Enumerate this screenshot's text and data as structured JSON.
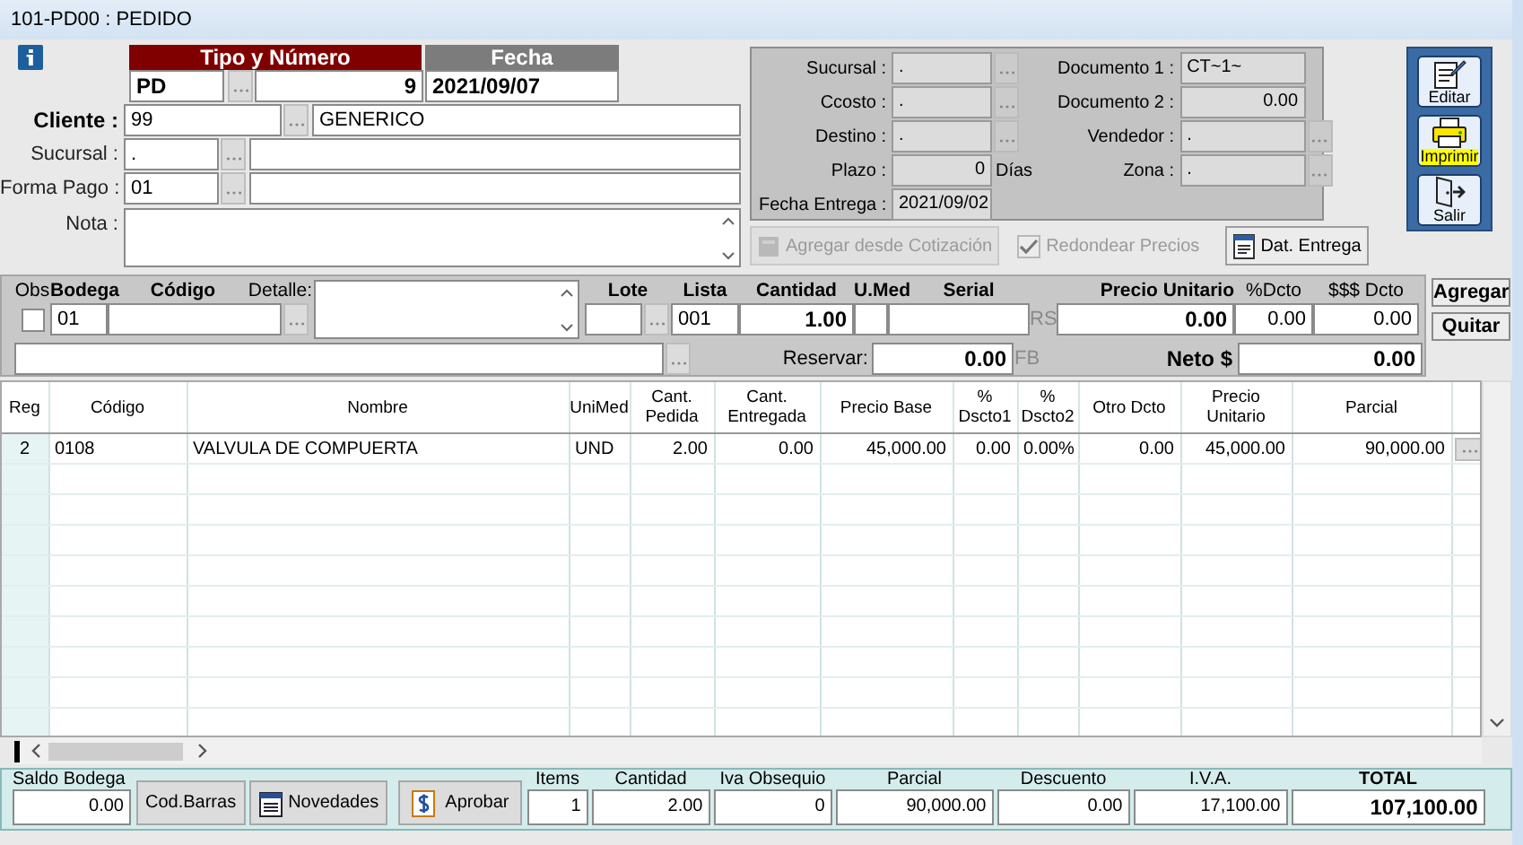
{
  "window": {
    "title": "101-PD00 : PEDIDO"
  },
  "document": {
    "type_header": "Tipo y Número",
    "date_header": "Fecha",
    "type": "PD",
    "number": "9",
    "date": "2021/09/07"
  },
  "client_fields": [
    {
      "label": "Cliente :",
      "code": "99",
      "description": "GENERICO",
      "kind": "primary"
    },
    {
      "label": "Sucursal :",
      "code": ".",
      "kind": "secondary"
    },
    {
      "label": "Forma Pago :",
      "code": "01",
      "kind": "secondary"
    }
  ],
  "note": {
    "label": "Nota :"
  },
  "details_panel": {
    "left": [
      {
        "label": "Sucursal :",
        "value": ".",
        "kind": "text",
        "lookup": true
      },
      {
        "label": "Ccosto :",
        "value": ".",
        "kind": "text",
        "lookup": true
      },
      {
        "label": "Destino :",
        "value": ".",
        "kind": "text",
        "lookup": true
      },
      {
        "label": "Plazo :",
        "value": "0",
        "kind": "number",
        "unit": "Días"
      },
      {
        "label": "Fecha Entrega :",
        "value": "2021/09/02",
        "kind": "text"
      }
    ],
    "right": [
      {
        "label": "Documento 1 :",
        "value": "CT~1~",
        "kind": "text"
      },
      {
        "label": "Documento 2 :",
        "value": "0.00",
        "kind": "number"
      },
      {
        "label": "Vendedor :",
        "value": ".",
        "kind": "text",
        "lookup": true
      },
      {
        "label": "Zona :",
        "value": ".",
        "kind": "text",
        "lookup": true
      }
    ]
  },
  "panel_actions": [
    {
      "kind": "button",
      "label": "Agregar desde Cotización",
      "disabled": true
    },
    {
      "kind": "checkbox",
      "label": "Redondear Precios",
      "checked": true,
      "disabled": true
    },
    {
      "kind": "button",
      "label": "Dat. Entrega",
      "disabled": false
    }
  ],
  "toolbar": [
    {
      "label": "Editar",
      "kind": "edit"
    },
    {
      "label": "Imprimir",
      "kind": "print"
    },
    {
      "label": "Salir",
      "kind": "exit"
    }
  ],
  "line_entry": {
    "obs_label": "Obs",
    "obs_checked": false,
    "bodega_label": "Bodega",
    "bodega": "01",
    "codigo_label": "Código",
    "detalle_label": "Detalle:",
    "lote_label": "Lote",
    "lista_label": "Lista",
    "lista": "001",
    "cantidad_label": "Cantidad",
    "cantidad": "1.00",
    "umed_label": "U.Med",
    "serial_label": "Serial",
    "rs_label": "RS",
    "precio_label": "Precio Unitario",
    "precio": "0.00",
    "dcto_label": "%Dcto",
    "dcto": "0.00",
    "dcto_valor_label": "$$$ Dcto",
    "dcto_valor": "0.00",
    "reservar_label": "Reservar:",
    "reservar": "0.00",
    "fb_label": "FB",
    "neto_label": "Neto $",
    "neto": "0.00"
  },
  "line_buttons": [
    "Agregar",
    "Quitar"
  ],
  "table": {
    "columns": [
      {
        "label": "Reg"
      },
      {
        "label": "Código"
      },
      {
        "label": "Nombre"
      },
      {
        "label": "UniMed"
      },
      {
        "label": "Cant.\nPedida"
      },
      {
        "label": "Cant.\nEntregada"
      },
      {
        "label": "Precio Base"
      },
      {
        "label": "%\nDscto1"
      },
      {
        "label": "%\nDscto2"
      },
      {
        "label": "Otro Dcto"
      },
      {
        "label": "Precio Unitario"
      },
      {
        "label": "Parcial"
      }
    ],
    "rows": [
      {
        "cells": [
          "2",
          "0108",
          "VALVULA DE COMPUERTA",
          "UND",
          "2.00",
          "0.00",
          "45,000.00",
          "0.00",
          "0.00%",
          "0.00",
          "45,000.00",
          "90,000.00"
        ]
      }
    ]
  },
  "footer": {
    "saldo_label": "Saldo Bodega",
    "saldo": "0.00",
    "buttons": [
      {
        "label": "Cod.Barras",
        "kind": "plain"
      },
      {
        "label": "Novedades",
        "kind": "notes"
      },
      {
        "label": "Aprobar",
        "kind": "approve"
      }
    ],
    "totals": [
      {
        "label": "Items",
        "value": "1",
        "emphasis": false
      },
      {
        "label": "Cantidad",
        "value": "2.00",
        "emphasis": false
      },
      {
        "label": "Iva Obsequio",
        "value": "0",
        "emphasis": false
      },
      {
        "label": "Parcial",
        "value": "90,000.00",
        "emphasis": false
      },
      {
        "label": "Descuento",
        "value": "0.00",
        "emphasis": false
      },
      {
        "label": "I.V.A.",
        "value": "17,100.00",
        "emphasis": false
      },
      {
        "label": "TOTAL",
        "value": "107,100.00",
        "emphasis": true
      }
    ]
  }
}
